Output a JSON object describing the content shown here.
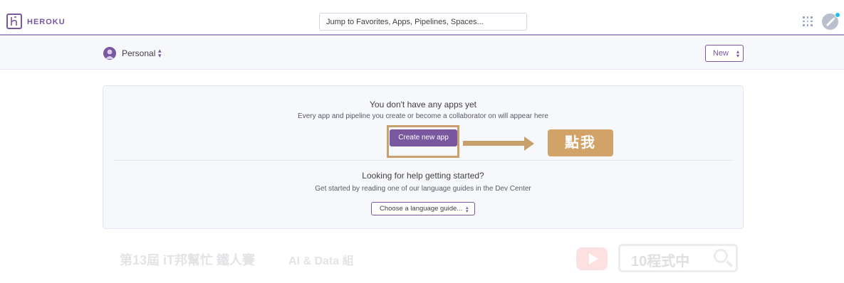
{
  "header": {
    "logo_text": "HEROKU",
    "search_placeholder": "Jump to Favorites, Apps, Pipelines, Spaces..."
  },
  "subheader": {
    "account_label": "Personal",
    "new_button": "New"
  },
  "empty_state": {
    "title": "You don't have any apps yet",
    "subtitle": "Every app and pipeline you create or become a collaborator on will appear here",
    "create_button": "Create new app"
  },
  "help": {
    "title": "Looking for help getting started?",
    "subtitle": "Get started by reading one of our language guides in the Dev Center",
    "language_button": "Choose a language guide..."
  },
  "annotation": {
    "click_label": "點我"
  },
  "watermark": {
    "event": "第13屆 iT邦幫忙 鐵人賽",
    "group": "AI & Data 組",
    "search_text": "10程式中"
  },
  "colors": {
    "brand": "#79589f",
    "annotation": "#c8a06d"
  }
}
